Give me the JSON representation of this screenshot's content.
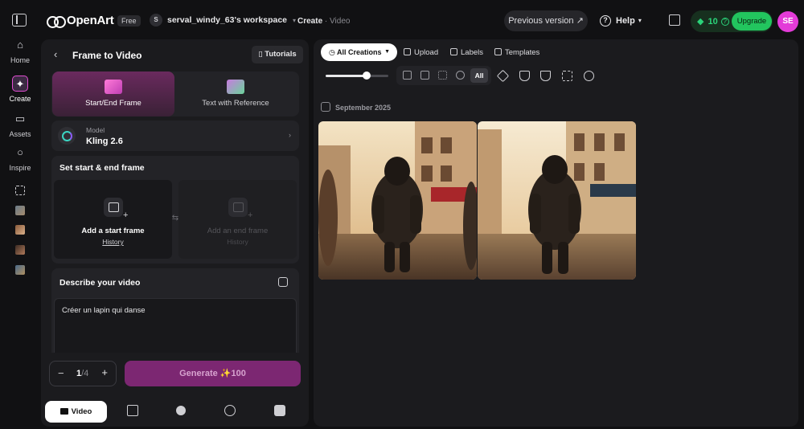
{
  "rail": {
    "items": [
      {
        "label": "Home",
        "icon": "home-icon"
      },
      {
        "label": "Create",
        "icon": "sparkle-icon"
      },
      {
        "label": "Assets",
        "icon": "folder-icon"
      },
      {
        "label": "Inspire",
        "icon": "lightbulb-icon"
      }
    ]
  },
  "topbar": {
    "brand": "OpenArt",
    "plan_badge": "Free",
    "workspace_initial": "S",
    "workspace": "serval_windy_63's workspace",
    "crumb_section": "Create",
    "crumb_sep": "·",
    "crumb_page": "Video",
    "previous_version": "Previous version ↗",
    "help": "Help",
    "credits": "10",
    "upgrade": "Upgrade",
    "avatar": "SE"
  },
  "panel": {
    "title": "Frame to Video",
    "tutorials": "Tutorials",
    "modes": [
      {
        "label": "Start/End Frame",
        "active": true
      },
      {
        "label": "Text with Reference",
        "active": false
      }
    ],
    "model": {
      "label": "Model",
      "name": "Kling 2.6"
    },
    "frames": {
      "title": "Set start & end frame",
      "start_label": "Add a start frame",
      "start_history": "History",
      "end_label": "Add an end frame",
      "end_history": "History"
    },
    "describe": {
      "title": "Describe your video",
      "prompt": "Créer un lapin qui danse"
    },
    "count": {
      "current": "1",
      "total": "/4"
    },
    "generate": "Generate ✨100",
    "bottom_tabs": {
      "video": "Video"
    }
  },
  "main": {
    "filter": "All Creations",
    "upload": "Upload",
    "labels": "Labels",
    "templates": "Templates",
    "type_all": "All",
    "zoom_fraction": 0.65,
    "date_group": "September 2025"
  }
}
